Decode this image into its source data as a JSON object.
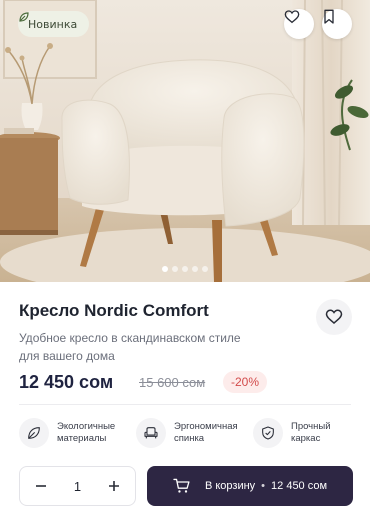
{
  "product": {
    "badge": "Новинка",
    "title": "Кресло Nordic Comfort",
    "subtitle": "Удобное кресло в скандинавском стиле для вашего дома",
    "price": "12 450 сом",
    "old_price": "15 600 сом",
    "discount": "-20%"
  },
  "gallery": {
    "slide_count": 5,
    "active_index": 0
  },
  "features": [
    {
      "icon": "leaf-icon",
      "label": "Экологичные материалы"
    },
    {
      "icon": "armchair-icon",
      "label": "Эргономичная спинка"
    },
    {
      "icon": "shield-check-icon",
      "label": "Прочный каркас"
    }
  ],
  "purchase": {
    "quantity": "1",
    "minus": "−",
    "plus": "+",
    "cart_label": "В корзину",
    "cart_separator": "•",
    "cart_price": "12 450 сом"
  },
  "colors": {
    "accent": "#2d2643",
    "discount_bg": "#fdeceb",
    "discount_text": "#d24b4b",
    "badge_bg": "#eef1e6"
  }
}
